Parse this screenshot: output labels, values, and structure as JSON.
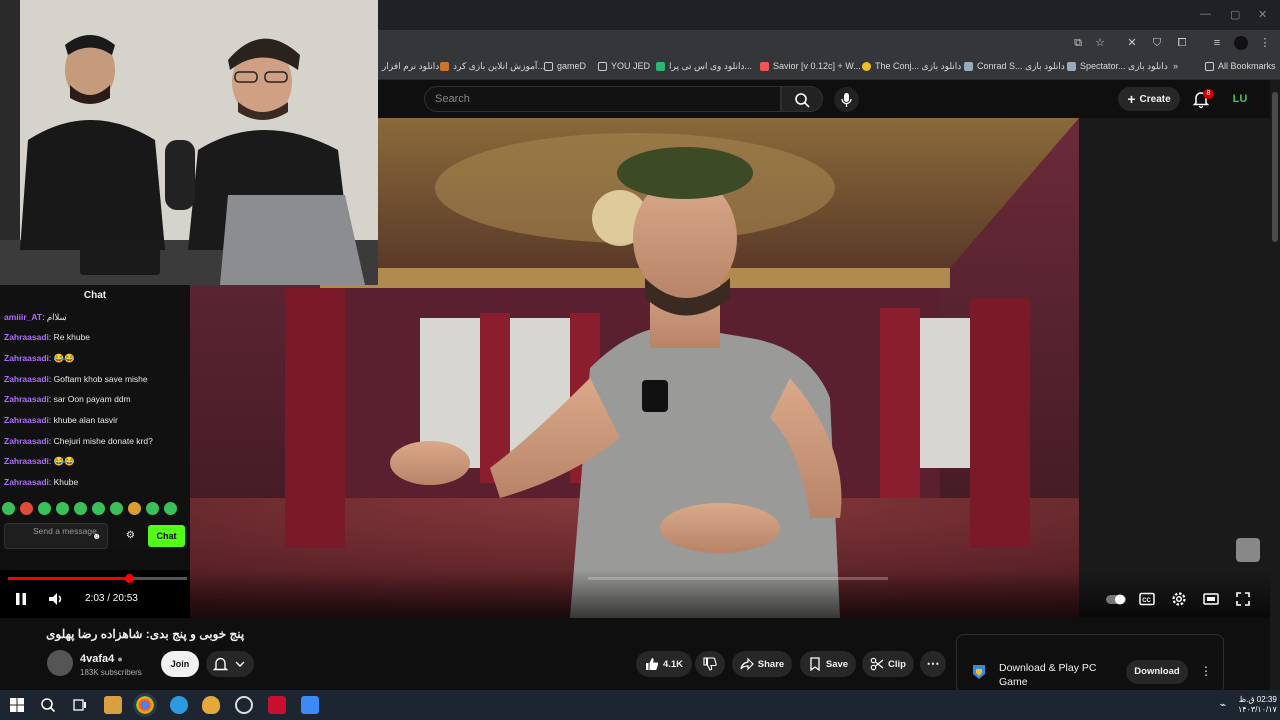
{
  "browser": {
    "bookmarks": [
      {
        "label": "دانلود نرم افزار"
      },
      {
        "label": "آموزش انلاین بازی کرد..."
      },
      {
        "label": "gameD"
      },
      {
        "label": "YOU JED"
      },
      {
        "label": "دانلود وی اس تی پرا..."
      },
      {
        "label": "Savior [v 0.12c] + W..."
      },
      {
        "label": "The Conj... دانلود بازی"
      },
      {
        "label": "Conrad S... دانلود بازی"
      },
      {
        "label": "Spectator... دانلود بازی"
      },
      {
        "label": "»"
      }
    ],
    "all_bookmarks": "All Bookmarks"
  },
  "header": {
    "search_placeholder": "Search",
    "create_label": "Create",
    "notifications_count": "8",
    "avatar_initials": "LU"
  },
  "stream_chat": {
    "title": "Chat",
    "messages": [
      {
        "user": "amiiir_AT",
        "text": "سلاام"
      },
      {
        "user": "Zahraasadi",
        "text": "Re khube"
      },
      {
        "user": "Zahraasadi",
        "text": "😂😂"
      },
      {
        "user": "Zahraasadi",
        "text": "Goftam khob save mishe"
      },
      {
        "user": "Zahraasadi",
        "text": "sar Oon payam ddm"
      },
      {
        "user": "Zahraasadi",
        "text": "khube alan tasvir"
      },
      {
        "user": "Zahraasadi",
        "text": "Chejuri mishe donate krd?"
      },
      {
        "user": "Zahraasadi",
        "text": "😂😂"
      },
      {
        "user": "Zahraasadi",
        "text": "Khube"
      }
    ],
    "send_placeholder": "Send a message",
    "chat_button": "Chat"
  },
  "player": {
    "current_time": "2:03",
    "duration": "20:53",
    "time_display": "2:03 / 20:53",
    "progress_fraction": 0.098
  },
  "video": {
    "title": "پنج خوبی و پنج بدی: شاهزاده رضا پهلوی",
    "channel": "4vafa4",
    "subscribers": "183K subscribers",
    "join_label": "Join",
    "likes": "4.1K",
    "share_label": "Share",
    "save_label": "Save",
    "clip_label": "Clip"
  },
  "ad": {
    "title": "Download & Play PC Game",
    "button": "Download"
  },
  "taskbar": {
    "time": "02:39 ق.ظ",
    "date": "۱۴۰۳/۱۰/۱۷"
  },
  "colors": {
    "youtube_red": "#ff0000",
    "kick_green": "#53fc18",
    "chat_username": "#b06bff"
  }
}
